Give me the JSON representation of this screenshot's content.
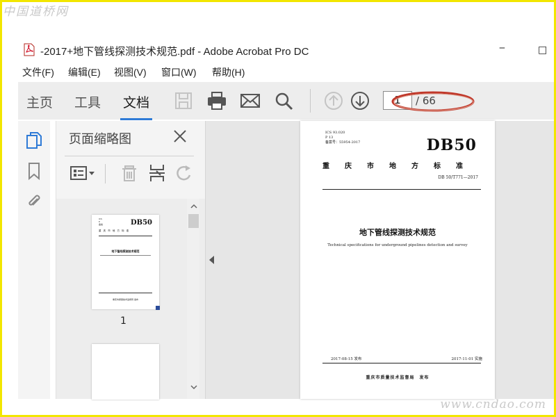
{
  "watermarks": {
    "top": "中国道桥网",
    "bottom": "www.cndao.com"
  },
  "window": {
    "title": "-2017+地下管线探测技术规范.pdf - Adobe Acrobat Pro DC",
    "maximize_glyph": "□"
  },
  "menu": {
    "items": [
      "文件(F)",
      "编辑(E)",
      "视图(V)",
      "窗口(W)",
      "帮助(H)"
    ]
  },
  "toolbar": {
    "tabs": [
      "主页",
      "工具",
      "文档"
    ],
    "active_tab": "文档",
    "buttons": [
      "save-icon",
      "print-icon",
      "email-icon",
      "search-icon",
      "page-up-icon",
      "page-down-icon"
    ],
    "page_current": "1",
    "page_total": "/ 66",
    "highlight_color": "#c0392b"
  },
  "rail": {
    "icons": [
      "page-thumbnails-icon",
      "bookmark-icon",
      "attachment-icon"
    ],
    "accent": "#2e7ad6"
  },
  "thumbnail_panel": {
    "title": "页面缩略图",
    "tools": [
      "thumbnail-options-icon",
      "delete-page-icon",
      "extract-page-icon",
      "rotate-page-icon"
    ],
    "pages": [
      {
        "label": "1",
        "mini_header": "DB50",
        "mini_org": "重 庆 市 地 方 标 准",
        "mini_title": "地下管线探测技术规范",
        "mini_issuer": "重庆市质量技术监督局 发布"
      }
    ]
  },
  "document": {
    "ics_line": "ICS 93.020",
    "p_line": "P 13",
    "record_line": "备案号：55954-2017",
    "header": "DB50",
    "org": "重庆市地方标准",
    "code": "DB 50/T771—2017",
    "title": "地下管线探测技术规范",
    "subtitle": "Technical specifications for underground pipelines detection and survey",
    "publish_date": "2017-08-15 发布",
    "implement_date": "2017-11-01 实施",
    "issuer": "重庆市质量技术监督局　发布"
  }
}
